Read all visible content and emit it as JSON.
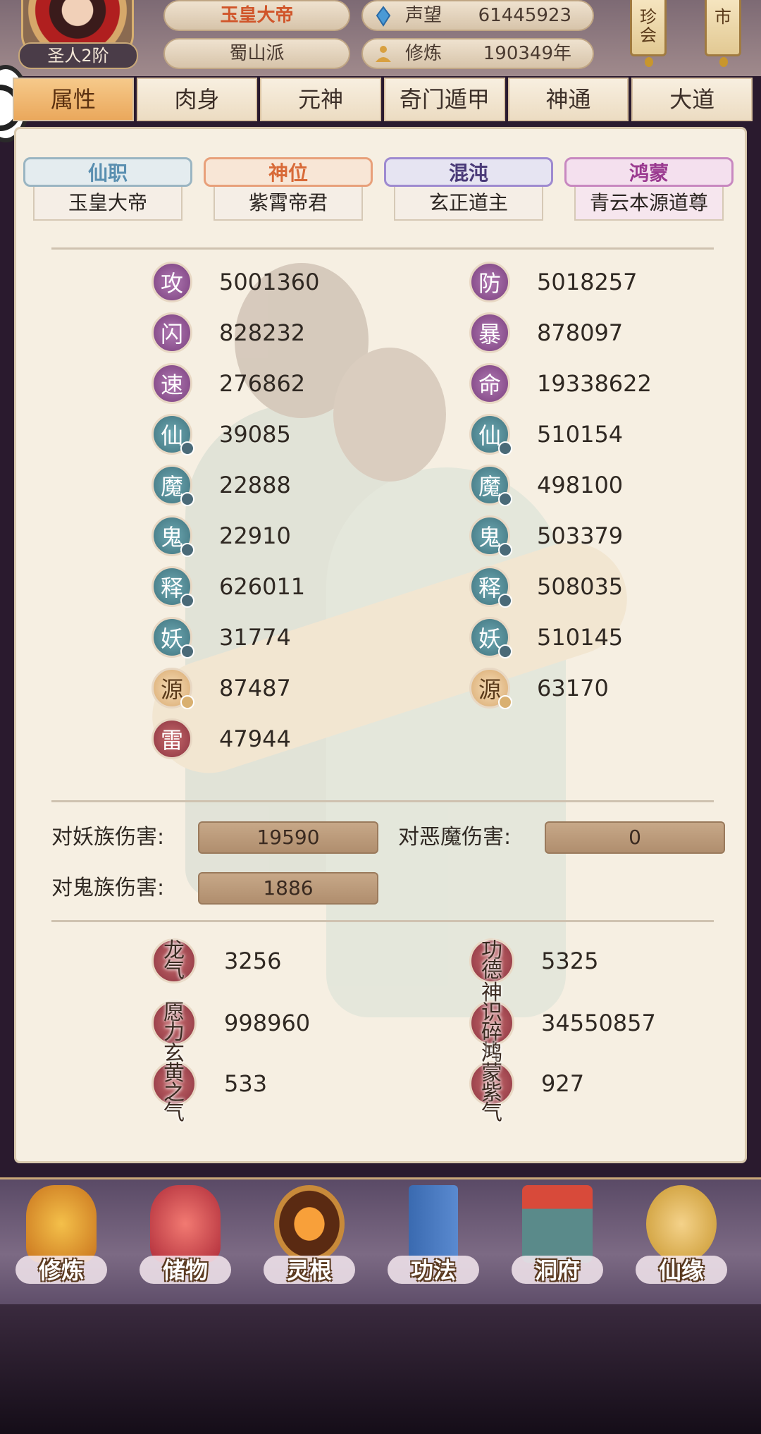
{
  "header": {
    "rank_badge": "圣人2阶",
    "title": "玉皇大帝",
    "sect": "蜀山派",
    "fame_label": "声望",
    "fame_value": "61445923",
    "cultivation_label": "修炼",
    "cultivation_value": "190349年",
    "btn_treasure": "珍会",
    "btn_market": "市"
  },
  "tabs": [
    {
      "label": "属性",
      "active": true
    },
    {
      "label": "肉身"
    },
    {
      "label": "元神"
    },
    {
      "label": "奇门遁甲"
    },
    {
      "label": "神通"
    },
    {
      "label": "大道"
    }
  ],
  "ranks": [
    {
      "title": "仙职",
      "value": "玉皇大帝"
    },
    {
      "title": "神位",
      "value": "紫霄帝君"
    },
    {
      "title": "混沌",
      "value": "玄正道主"
    },
    {
      "title": "鸿蒙",
      "value": "青云本源道尊"
    }
  ],
  "stats_left": [
    {
      "icon": "攻",
      "value": "5001360"
    },
    {
      "icon": "闪",
      "value": "828232"
    },
    {
      "icon": "速",
      "value": "276862"
    },
    {
      "icon": "仙",
      "value": "39085"
    },
    {
      "icon": "魔",
      "value": "22888"
    },
    {
      "icon": "鬼",
      "value": "22910"
    },
    {
      "icon": "释",
      "value": "626011"
    },
    {
      "icon": "妖",
      "value": "31774"
    },
    {
      "icon": "源",
      "value": "87487"
    },
    {
      "icon": "雷",
      "value": "47944"
    }
  ],
  "stats_right": [
    {
      "icon": "防",
      "value": "5018257"
    },
    {
      "icon": "暴",
      "value": "878097"
    },
    {
      "icon": "命",
      "value": "19338622"
    },
    {
      "icon": "仙",
      "value": "510154"
    },
    {
      "icon": "魔",
      "value": "498100"
    },
    {
      "icon": "鬼",
      "value": "503379"
    },
    {
      "icon": "释",
      "value": "508035"
    },
    {
      "icon": "妖",
      "value": "510145"
    },
    {
      "icon": "源",
      "value": "63170"
    }
  ],
  "damage": {
    "demon_label": "对妖族伤害:",
    "demon_value": "19590",
    "devil_label": "对恶魔伤害:",
    "devil_value": "0",
    "ghost_label": "对鬼族伤害:",
    "ghost_value": "1886"
  },
  "special": {
    "dragon_label": "龙气",
    "dragon_value": "3256",
    "merit_label": "功德",
    "merit_value": "5325",
    "wish_label": "愿力",
    "wish_value": "998960",
    "spirit_label": "神识碎片",
    "spirit_value": "34550857",
    "xuanhuang_label": "玄黄之气",
    "xuanhuang_value": "533",
    "hongmeng_label": "鸿蒙紫气",
    "hongmeng_value": "927"
  },
  "nav": [
    {
      "label": "修炼"
    },
    {
      "label": "储物"
    },
    {
      "label": "灵根"
    },
    {
      "label": "功法"
    },
    {
      "label": "洞府"
    },
    {
      "label": "仙缘"
    }
  ]
}
